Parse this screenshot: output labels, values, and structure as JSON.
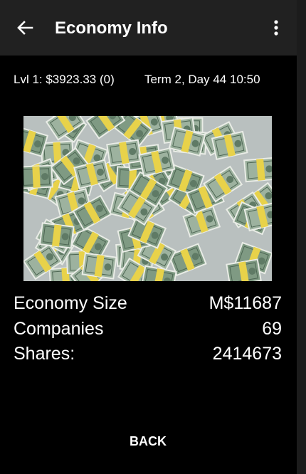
{
  "appbar": {
    "title": "Economy Info",
    "back_icon": "arrow-left-icon",
    "menu_icon": "more-vert-icon"
  },
  "status": {
    "level_cash": "Lvl 1: $3923.33 (0)",
    "term_time": "Term 2, Day 44  10:50"
  },
  "hero_image": "stack-of-money-image",
  "stats": [
    {
      "label": "Economy Size",
      "value": "M$11687"
    },
    {
      "label": "Companies",
      "value": "69"
    },
    {
      "label": "Shares:",
      "value": "2414673"
    }
  ],
  "footer": {
    "back_label": "BACK"
  }
}
